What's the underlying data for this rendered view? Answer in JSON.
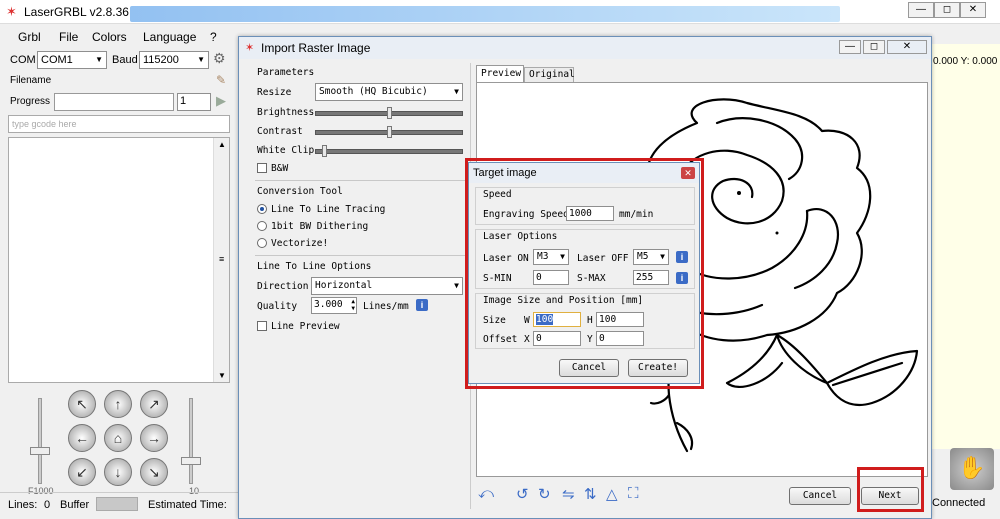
{
  "main_window": {
    "title": "LaserGRBL v2.8.36",
    "menu": [
      "Grbl",
      "File",
      "Colors",
      "Language",
      "?"
    ],
    "com_label": "COM",
    "com_value": "COM1",
    "baud_label": "Baud",
    "baud_value": "115200",
    "filename_label": "Filename",
    "progress_label": "Progress",
    "progress_count": "1",
    "gcode_placeholder": "type gcode here",
    "slider_left_label": "F1000",
    "slider_right_label": "10",
    "status": {
      "lines_label": "Lines:",
      "lines_value": "0",
      "buffer_label": "Buffer",
      "estimated_label": "Estimated Time:"
    },
    "coords": "0.000 Y: 0.000",
    "connection_status": "Connected"
  },
  "dialog": {
    "title": "Import Raster Image",
    "parameters": {
      "label": "Parameters",
      "resize_label": "Resize",
      "resize_value": "Smooth (HQ Bicubic)",
      "brightness_label": "Brightness",
      "brightness_level": 0.5,
      "contrast_label": "Contrast",
      "contrast_level": 0.5,
      "whiteclip_label": "White Clip",
      "whiteclip_level": 0.05,
      "bw_label": "B&W"
    },
    "conversion": {
      "label": "Conversion Tool",
      "options": [
        "Line To Line Tracing",
        "1bit BW Dithering",
        "Vectorize!"
      ],
      "selected_index": 0
    },
    "line_options": {
      "label": "Line To Line Options",
      "direction_label": "Direction",
      "direction_value": "Horizontal",
      "quality_label": "Quality",
      "quality_value": "3.000",
      "quality_unit": "Lines/mm",
      "preview_label": "Line Preview"
    },
    "tabs": [
      "Preview",
      "Original"
    ],
    "active_tab": 0,
    "cancel_label": "Cancel",
    "next_label": "Next"
  },
  "target_dialog": {
    "title": "Target image",
    "speed_group": "Speed",
    "engraving_speed_label": "Engraving Speed",
    "engraving_speed_value": "1000",
    "engraving_speed_unit": "mm/min",
    "laser_group": "Laser Options",
    "laser_on_label": "Laser ON",
    "laser_on_value": "M3",
    "laser_off_label": "Laser OFF",
    "laser_off_value": "M5",
    "smin_label": "S-MIN",
    "smin_value": "0",
    "smax_label": "S-MAX",
    "smax_value": "255",
    "size_group": "Image Size and Position [mm]",
    "size_label": "Size",
    "w_label": "W",
    "w_value": "100",
    "h_label": "H",
    "h_value": "100",
    "offset_label": "Offset",
    "x_label": "X",
    "x_value": "0",
    "y_label": "Y",
    "y_value": "0",
    "cancel_label": "Cancel",
    "create_label": "Create!"
  },
  "colors": {
    "highlight": "#d01c1c",
    "accent": "#3b6bc6"
  }
}
